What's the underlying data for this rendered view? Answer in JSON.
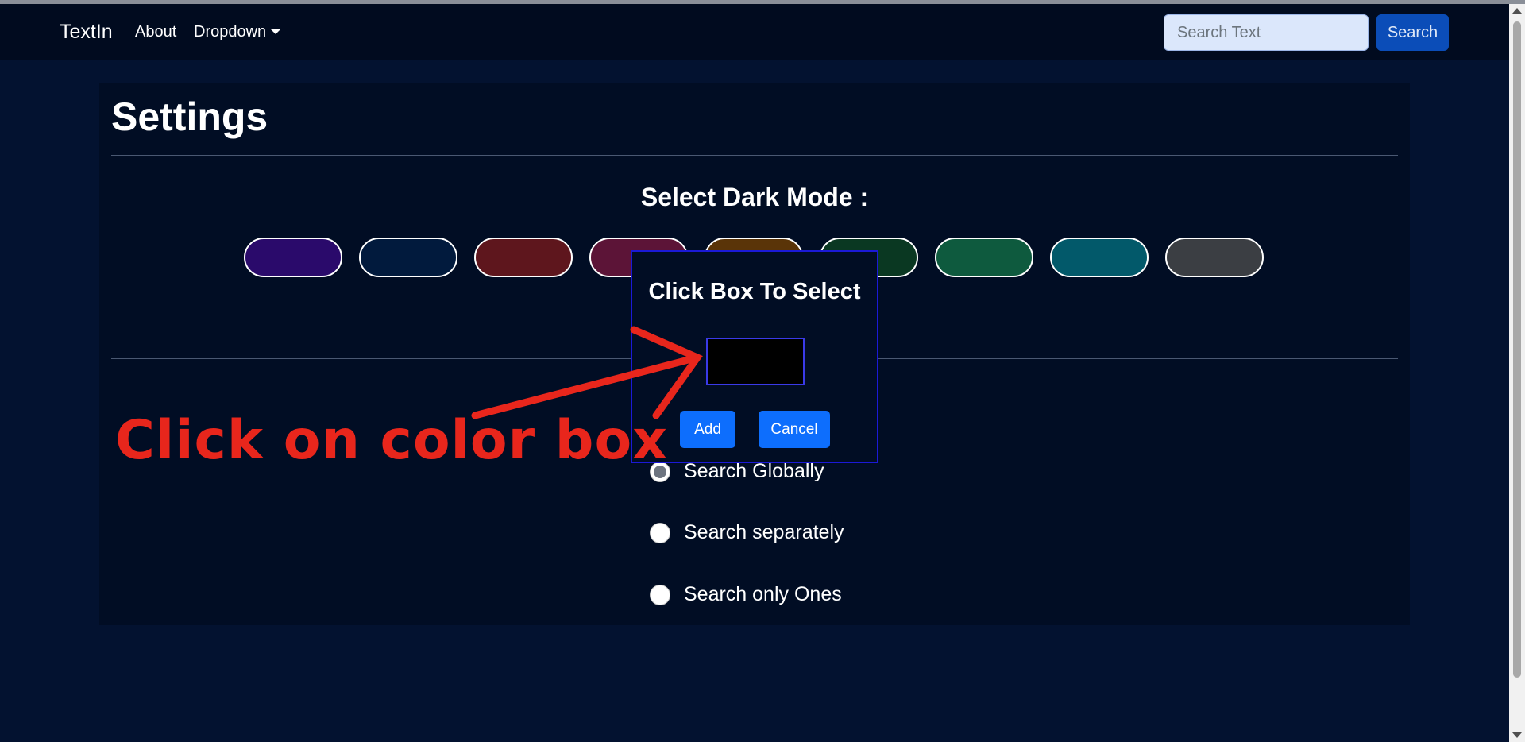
{
  "navbar": {
    "brand": "TextIn",
    "about_label": "About",
    "dropdown_label": "Dropdown",
    "search_placeholder": "Search Text",
    "search_button": "Search"
  },
  "settings": {
    "title": "Settings",
    "dark_mode_heading": "Select Dark Mode :",
    "swatches": [
      {
        "color": "#2a0a6b"
      },
      {
        "color": "#011a3d"
      },
      {
        "color": "#5e161d"
      },
      {
        "color": "#5c1437"
      },
      {
        "color": "#5a3408"
      },
      {
        "color": "#0a3822"
      },
      {
        "color": "#0e5a3e"
      },
      {
        "color": "#02596a"
      },
      {
        "color": "#3b3e43"
      }
    ],
    "search_options": [
      {
        "label": "Search Globally",
        "checked": true
      },
      {
        "label": "Search separately",
        "checked": false
      },
      {
        "label": "Search only Ones",
        "checked": false
      }
    ]
  },
  "modal": {
    "title": "Click Box To Select",
    "color_value": "#000000",
    "add_label": "Add",
    "cancel_label": "Cancel"
  },
  "annotation": {
    "text": "Click on color box",
    "color": "#e8261c"
  }
}
